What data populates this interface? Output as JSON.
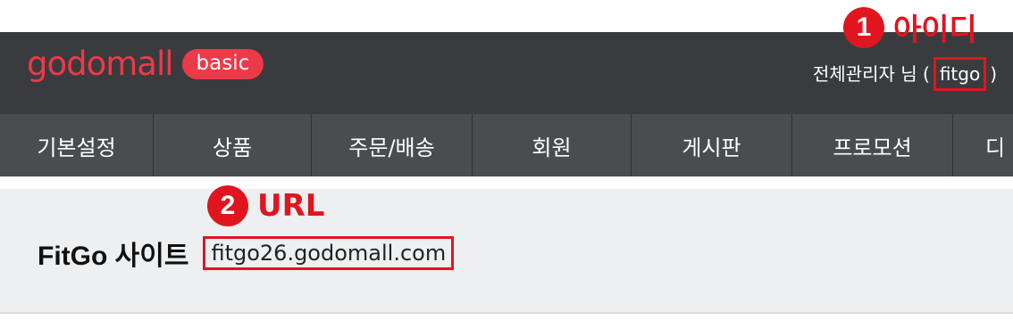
{
  "header": {
    "logo_text": "godomall",
    "logo_badge": "basic",
    "user_label": "전체관리자 님 (",
    "user_id": "fitgo",
    "user_suffix": ")"
  },
  "nav": {
    "items": [
      "기본설정",
      "상품",
      "주문/배송",
      "회원",
      "게시판",
      "프로모션",
      "디"
    ]
  },
  "site": {
    "title": "FitGo 사이트",
    "url": "fitgo26.godomall.com"
  },
  "annotations": [
    {
      "number": "1",
      "label": "아이디"
    },
    {
      "number": "2",
      "label": "URL"
    }
  ],
  "colors": {
    "header_bg": "#3a3b3e",
    "nav_bg": "#4b4c50",
    "brand_red": "#ec3a48",
    "annotation_red": "#e0151e"
  }
}
